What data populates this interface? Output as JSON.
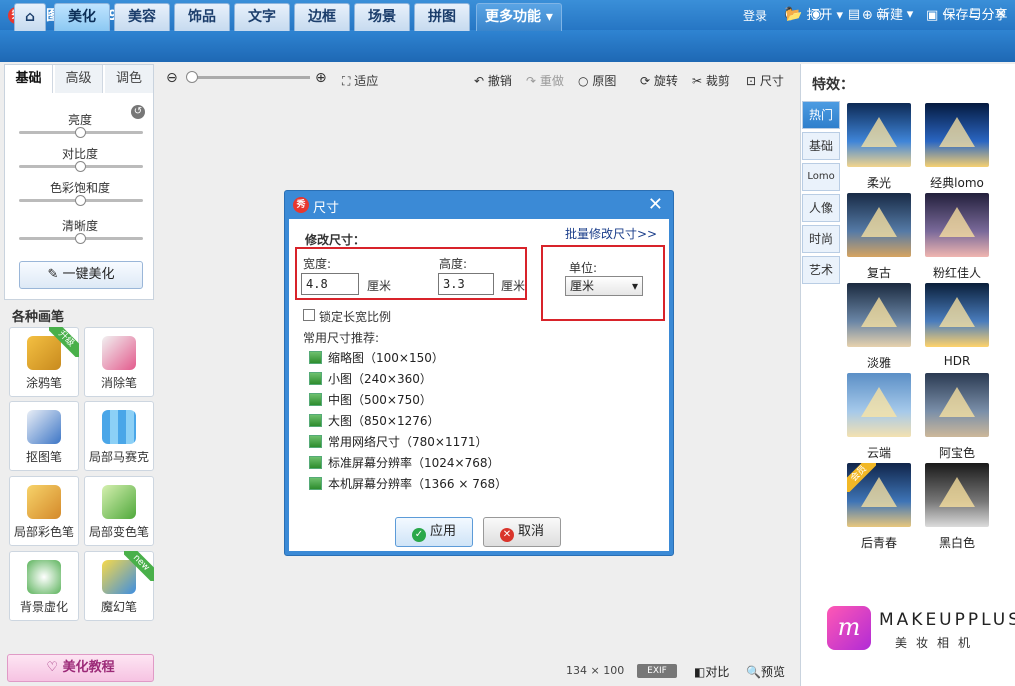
{
  "app": {
    "title": "美图秀秀 3.9.6",
    "logo_glyph": "秀",
    "login": "登录"
  },
  "nav": {
    "tabs": [
      "美化",
      "美容",
      "饰品",
      "文字",
      "边框",
      "场景",
      "拼图"
    ],
    "active_tab": "美化",
    "more": "更多功能",
    "open": "打开",
    "new": "新建",
    "save_share": "保存与分享"
  },
  "adjust": {
    "tabs": [
      "基础",
      "高级",
      "调色"
    ],
    "active_tab": "基础",
    "sliders": [
      "亮度",
      "对比度",
      "色彩饱和度",
      "清晰度"
    ],
    "one_click": "一键美化"
  },
  "brushes": {
    "title": "各种画笔",
    "items": [
      {
        "label": "涂鸦笔",
        "badge": "升级"
      },
      {
        "label": "消除笔",
        "badge": ""
      },
      {
        "label": "抠图笔",
        "badge": ""
      },
      {
        "label": "局部马赛克",
        "badge": ""
      },
      {
        "label": "局部彩色笔",
        "badge": ""
      },
      {
        "label": "局部变色笔",
        "badge": ""
      },
      {
        "label": "背景虚化",
        "badge": ""
      },
      {
        "label": "魔幻笔",
        "badge": "new"
      }
    ],
    "tutorial": "美化教程"
  },
  "toolbar": {
    "fit": "适应",
    "undo": "撤销",
    "redo": "重做",
    "original": "原图",
    "rotate": "旋转",
    "crop": "裁剪",
    "resize": "尺寸"
  },
  "status": {
    "size": "134 × 100",
    "exif": "EXIF",
    "compare": "对比",
    "preview": "预览"
  },
  "effects": {
    "title": "特效：",
    "tabs": [
      "热门",
      "基础",
      "Lomo",
      "人像",
      "时尚",
      "艺术"
    ],
    "active_tab": "热门",
    "items": [
      {
        "label": "柔光",
        "badge": ""
      },
      {
        "label": "经典lomo",
        "badge": ""
      },
      {
        "label": "复古",
        "badge": ""
      },
      {
        "label": "粉红佳人",
        "badge": ""
      },
      {
        "label": "淡雅",
        "badge": ""
      },
      {
        "label": "HDR",
        "badge": ""
      },
      {
        "label": "云端",
        "badge": ""
      },
      {
        "label": "阿宝色",
        "badge": ""
      },
      {
        "label": "后青春",
        "badge": "会员"
      },
      {
        "label": "黑白色",
        "badge": ""
      }
    ]
  },
  "ad": {
    "glyph": "m",
    "brand": "MAKEUPPLUS",
    "sub": "美妆相机"
  },
  "dialog": {
    "title": "尺寸",
    "section": "修改尺寸：",
    "batch_link": "批量修改尺寸>>",
    "width_label": "宽度:",
    "width_value": "4.8",
    "height_label": "高度:",
    "height_value": "3.3",
    "unit_suffix": "厘米",
    "unit_label": "单位:",
    "unit_value": "厘米",
    "lock_ratio": "锁定长宽比例",
    "presets_title": "常用尺寸推荐:",
    "presets": [
      "缩略图（100×150）",
      "小图（240×360）",
      "中图（500×750）",
      "大图（850×1276）",
      "常用网络尺寸（780×1171）",
      "标准屏幕分辨率（1024×768）",
      "本机屏幕分辨率（1366 × 768）"
    ],
    "ok": "应用",
    "cancel": "取消"
  }
}
